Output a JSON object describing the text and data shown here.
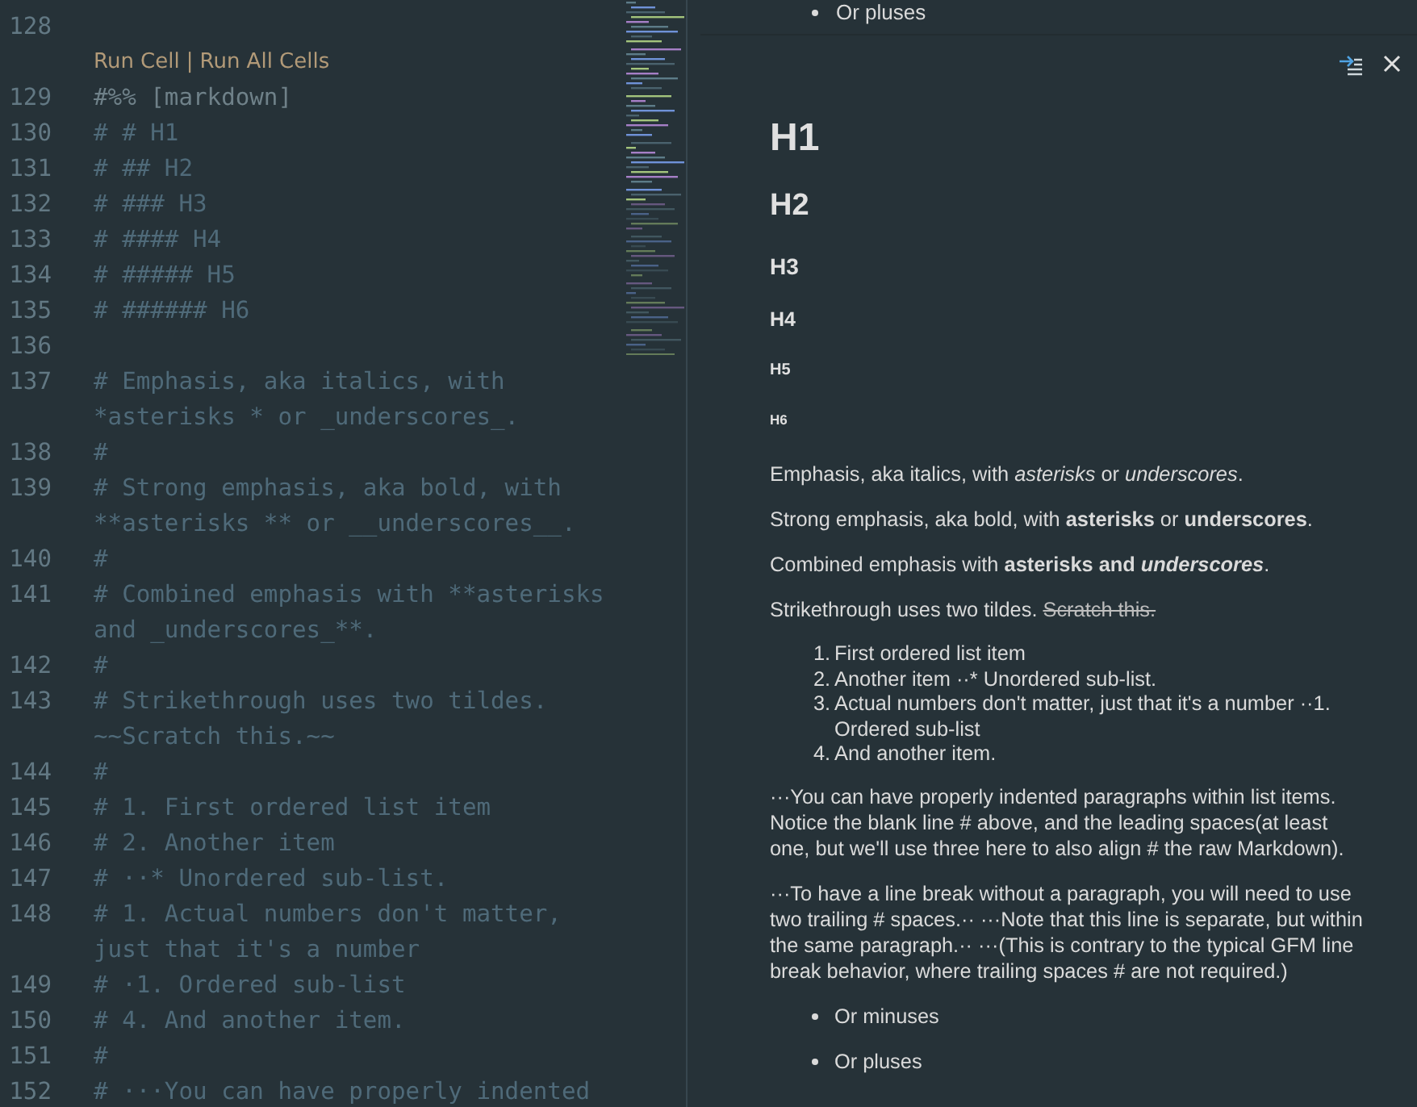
{
  "editor": {
    "lines": [
      {
        "kind": "code",
        "number": "128"
      },
      {
        "kind": "lens",
        "links": [
          "Run Cell",
          "|",
          "Run All Cells"
        ]
      },
      {
        "kind": "marker",
        "number": "129",
        "text": "#%% [markdown]"
      },
      {
        "kind": "code",
        "number": "130",
        "text": "# # H1"
      },
      {
        "kind": "code",
        "number": "131",
        "text": "# ## H2"
      },
      {
        "kind": "code",
        "number": "132",
        "text": "# ### H3"
      },
      {
        "kind": "code",
        "number": "133",
        "text": "# #### H4"
      },
      {
        "kind": "code",
        "number": "134",
        "text": "# ##### H5"
      },
      {
        "kind": "code",
        "number": "135",
        "text": "# ###### H6"
      },
      {
        "kind": "code",
        "number": "136"
      },
      {
        "kind": "code",
        "number": "137",
        "text": "# Emphasis, aka italics, with *asterisks * or _underscores_."
      },
      {
        "kind": "code",
        "number": "138",
        "text": "#"
      },
      {
        "kind": "code",
        "number": "139",
        "text": "# Strong emphasis, aka bold, with **asterisks ** or __underscores__."
      },
      {
        "kind": "code",
        "number": "140",
        "text": "#"
      },
      {
        "kind": "code",
        "number": "141",
        "text": "# Combined emphasis with **asterisks and _underscores_**."
      },
      {
        "kind": "code",
        "number": "142",
        "text": "#"
      },
      {
        "kind": "code",
        "number": "143",
        "text": "# Strikethrough uses two tildes. ~~Scratch this.~~"
      },
      {
        "kind": "code",
        "number": "144",
        "text": "#"
      },
      {
        "kind": "code",
        "number": "145",
        "text": "# 1. First ordered list item"
      },
      {
        "kind": "code",
        "number": "146",
        "text": "# 2. Another item"
      },
      {
        "kind": "code",
        "number": "147",
        "text": "# ··* Unordered sub-list."
      },
      {
        "kind": "code",
        "number": "148",
        "text": "# 1. Actual numbers don't matter, just that it's a number"
      },
      {
        "kind": "code",
        "number": "149",
        "text": "# ·1. Ordered sub-list"
      },
      {
        "kind": "code",
        "number": "150",
        "text": "# 4. And another item."
      },
      {
        "kind": "code",
        "number": "151",
        "text": "#"
      },
      {
        "kind": "code",
        "number": "152",
        "text": "# ···You can have properly indented"
      }
    ]
  },
  "preview": {
    "cut_item": "Or pluses",
    "blocks": [
      {
        "kind": "h1",
        "text": "H1"
      },
      {
        "kind": "h2",
        "text": "H2"
      },
      {
        "kind": "h3",
        "text": "H3"
      },
      {
        "kind": "h4",
        "text": "H4"
      },
      {
        "kind": "h5",
        "text": "H5"
      },
      {
        "kind": "h6",
        "text": "H6"
      },
      {
        "kind": "paragraph",
        "text": "Emphasis, aka italics, with *asterisks* or *underscores*."
      },
      {
        "kind": "paragraph",
        "text": "Strong emphasis, aka bold, with **asterisks** or **underscores**."
      },
      {
        "kind": "paragraph",
        "text": "Combined emphasis with **asterisks and** *underscores*.",
        "em_bold": true
      },
      {
        "kind": "paragraph",
        "text": "Strikethrough uses two tildes. ",
        "struck": "Scratch this."
      },
      {
        "kind": "ordered",
        "items": [
          {
            "marker": "1.",
            "text": "First ordered list item"
          },
          {
            "marker": "2.",
            "text": "Another item ··* Unordered sub-list."
          },
          {
            "marker": "3.",
            "text": "Actual numbers don't matter, just that it's a number ··1. Ordered sub-list"
          },
          {
            "marker": "4.",
            "text": "And another item."
          }
        ]
      },
      {
        "kind": "paragraph",
        "text": "···You can have properly indented paragraphs within list items. Notice the blank line # above, and the leading spaces(at least one, but we'll use three here to also align # the raw Markdown)."
      },
      {
        "kind": "paragraph",
        "text": "···To have a line break without a paragraph, you will need to use two trailing # spaces.·· ···Note that this line is separate, but within the same paragraph.·· ···(This is contrary to the typical GFM line break behavior, where trailing spaces # are not required.)"
      },
      {
        "kind": "bullets",
        "items": [
          "Or minuses",
          "Or pluses"
        ]
      }
    ]
  }
}
